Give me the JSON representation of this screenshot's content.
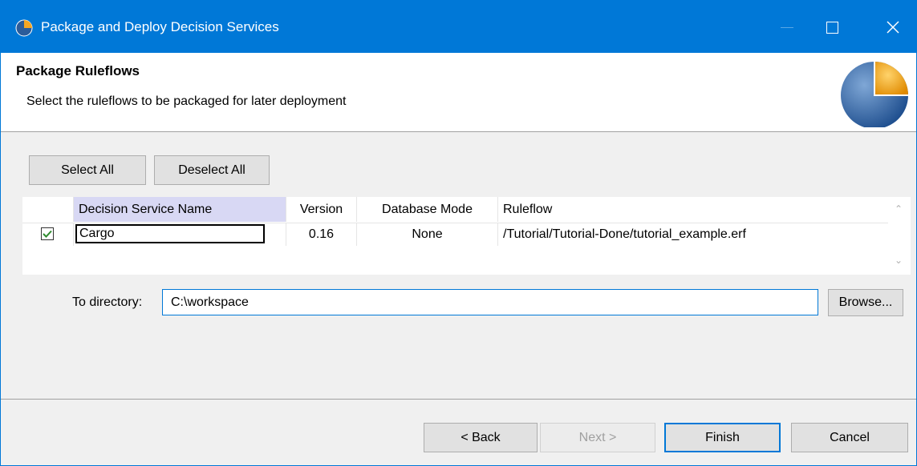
{
  "window": {
    "title": "Package and Deploy Decision Services",
    "minimize_icon": "minimize-icon",
    "maximize_icon": "maximize-icon",
    "close_icon": "close-icon"
  },
  "header": {
    "title": "Package Ruleflows",
    "description": "Select the ruleflows to be packaged for later deployment"
  },
  "toolbar": {
    "select_all": "Select All",
    "deselect_all": "Deselect All"
  },
  "table": {
    "columns": [
      "Decision Service Name",
      "Version",
      "Database Mode",
      "Ruleflow"
    ],
    "rows": [
      {
        "checked": true,
        "name": "Cargo",
        "version": "0.16",
        "database_mode": "None",
        "ruleflow": "/Tutorial/Tutorial-Done/tutorial_example.erf"
      }
    ]
  },
  "directory": {
    "label": "To directory:",
    "value": "C:\\workspace",
    "browse": "Browse..."
  },
  "footer": {
    "back": "< Back",
    "next": "Next >",
    "finish": "Finish",
    "cancel": "Cancel"
  },
  "colors": {
    "titlebar": "#0078d7",
    "accent": "#0078d7",
    "sorted_header": "#d8d8f4"
  }
}
